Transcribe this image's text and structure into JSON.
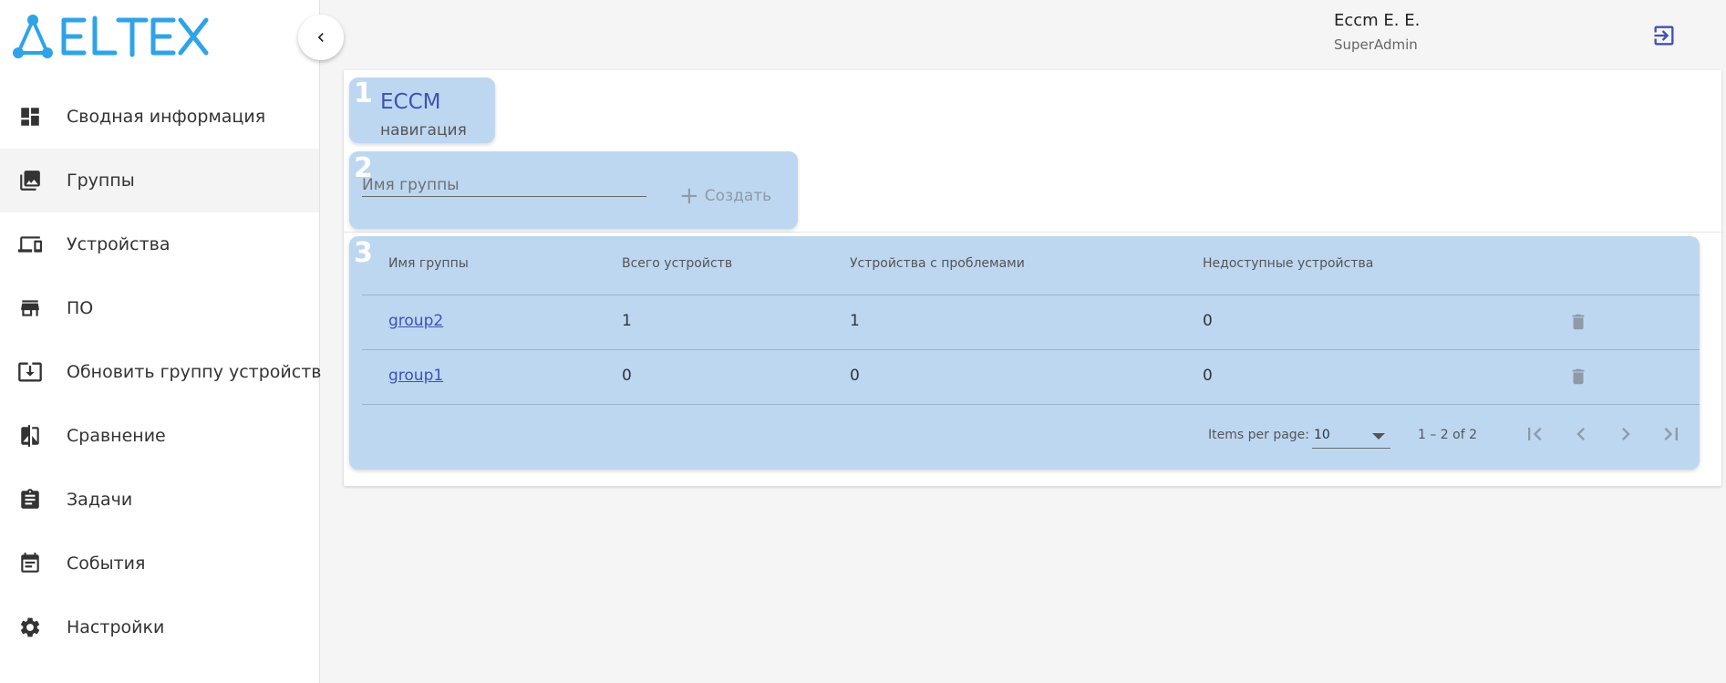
{
  "app": {
    "logo_text": "ELTEX"
  },
  "user": {
    "name": "Eccm E. E.",
    "role": "SuperAdmin"
  },
  "sidebar": {
    "items": [
      {
        "label": "Сводная информация",
        "icon": "dashboard-icon"
      },
      {
        "label": "Группы",
        "icon": "photo-library-icon",
        "active": true
      },
      {
        "label": "Устройства",
        "icon": "devices-icon"
      },
      {
        "label": "ПО",
        "icon": "store-icon"
      },
      {
        "label": "Обновить группу устройств",
        "icon": "system-update-icon"
      },
      {
        "label": "Сравнение",
        "icon": "compare-icon"
      },
      {
        "label": "Задачи",
        "icon": "assignment-icon"
      },
      {
        "label": "События",
        "icon": "event-note-icon"
      },
      {
        "label": "Настройки",
        "icon": "gear-icon"
      }
    ]
  },
  "block1": {
    "number": "1",
    "title": "ECCM",
    "subtitle": "навигация"
  },
  "block2": {
    "number": "2",
    "placeholder": "Имя группы",
    "create_label": "Создать"
  },
  "block3": {
    "number": "3",
    "columns": [
      "Имя группы",
      "Всего устройств",
      "Устройства с проблемами",
      "Недоступные устройства"
    ],
    "rows": [
      {
        "name": "group2",
        "total": "1",
        "problems": "1",
        "unavailable": "0"
      },
      {
        "name": "group1",
        "total": "0",
        "problems": "0",
        "unavailable": "0"
      }
    ],
    "pagination": {
      "items_per_page_label": "Items per page:",
      "items_per_page": "10",
      "range": "1 – 2 of 2"
    }
  },
  "colors": {
    "accent": "#3f51b5",
    "highlight_block": "#bdd7f1"
  }
}
